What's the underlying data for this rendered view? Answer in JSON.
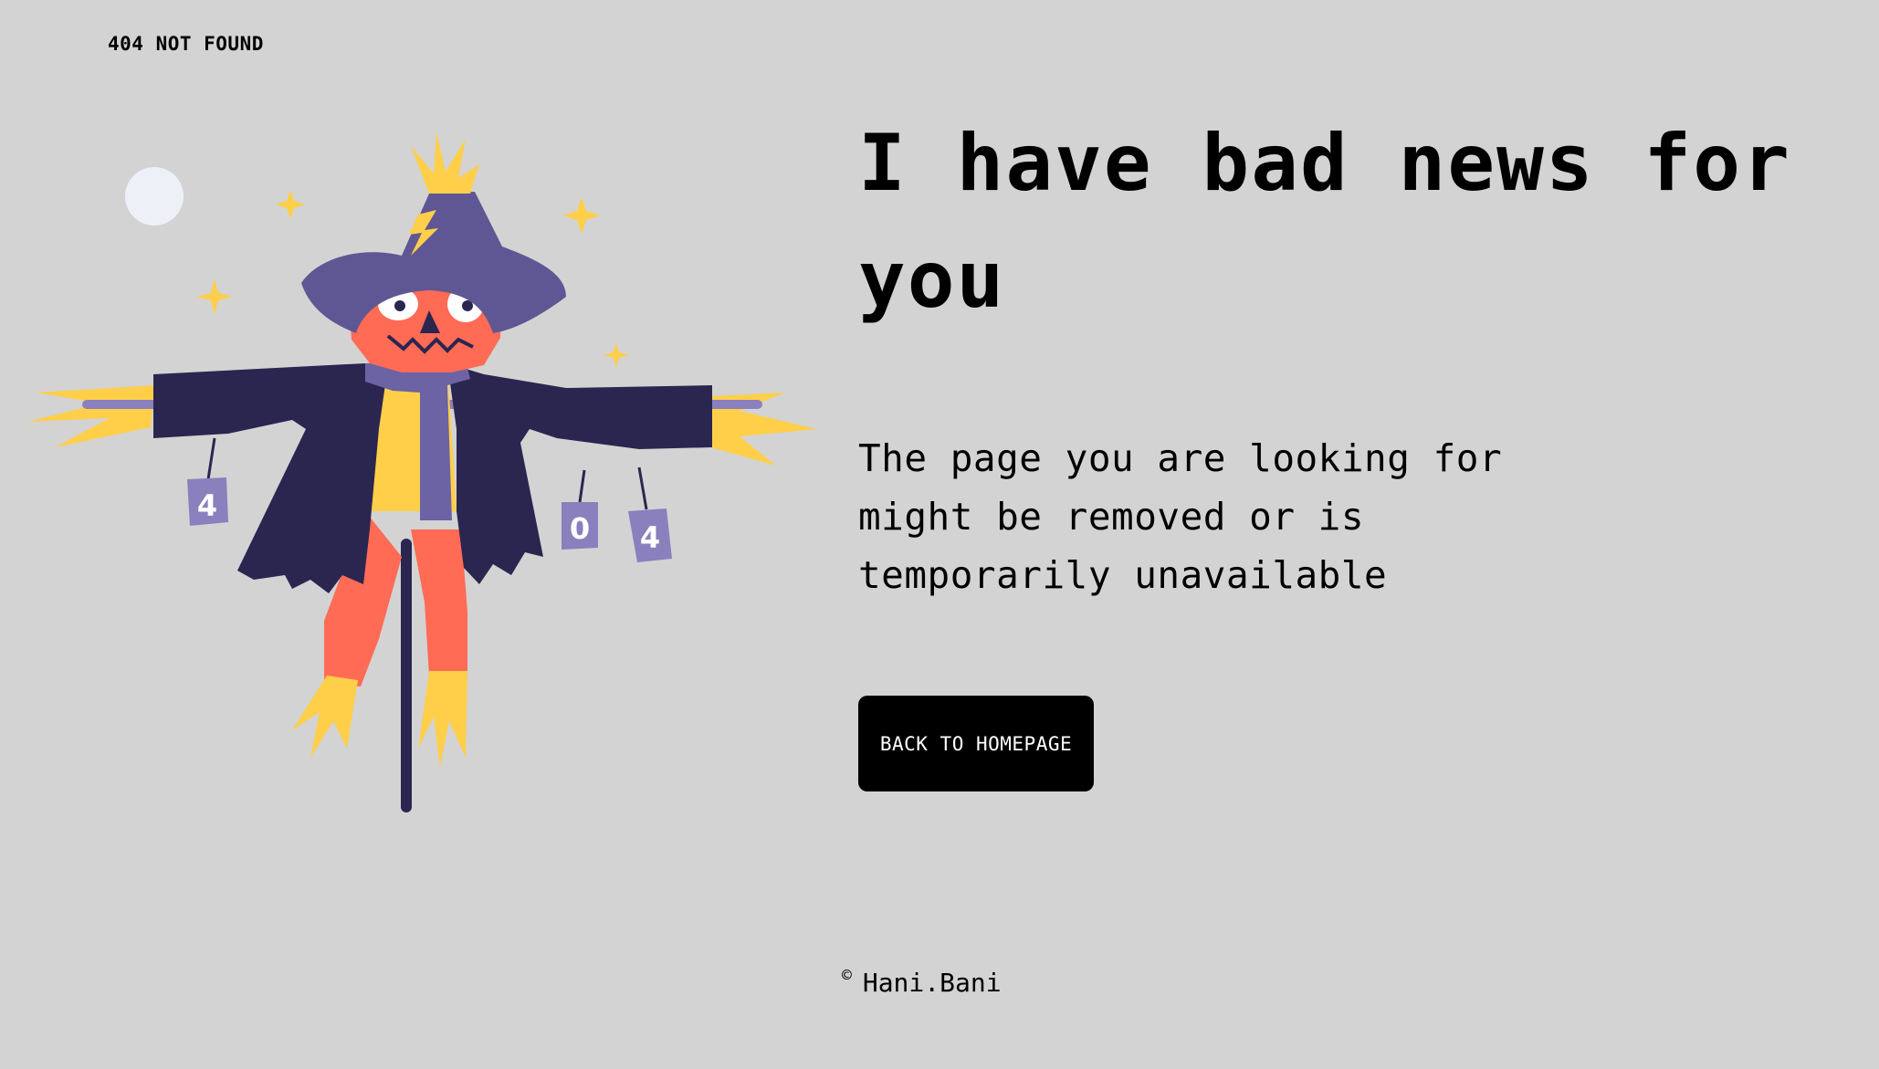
{
  "header": {
    "label": "404 NOT FOUND"
  },
  "main": {
    "headline": "I have bad news for you",
    "description": "The page you are looking for might be removed or is temporarily unavailable",
    "button_label": "BACK TO HOMEPAGE"
  },
  "illustration": {
    "cans": [
      "4",
      "0",
      "4"
    ],
    "colors": {
      "background": "#d3d3d3",
      "coat": "#2a2650",
      "hat": "#5f5794",
      "scarf": "#6b63a3",
      "face": "#ff6b55",
      "straw": "#ffcf4a",
      "moon": "#eef0f8",
      "can": "#8a80bd"
    }
  },
  "footer": {
    "copyright_symbol": "©",
    "author": "Hani.Bani"
  }
}
